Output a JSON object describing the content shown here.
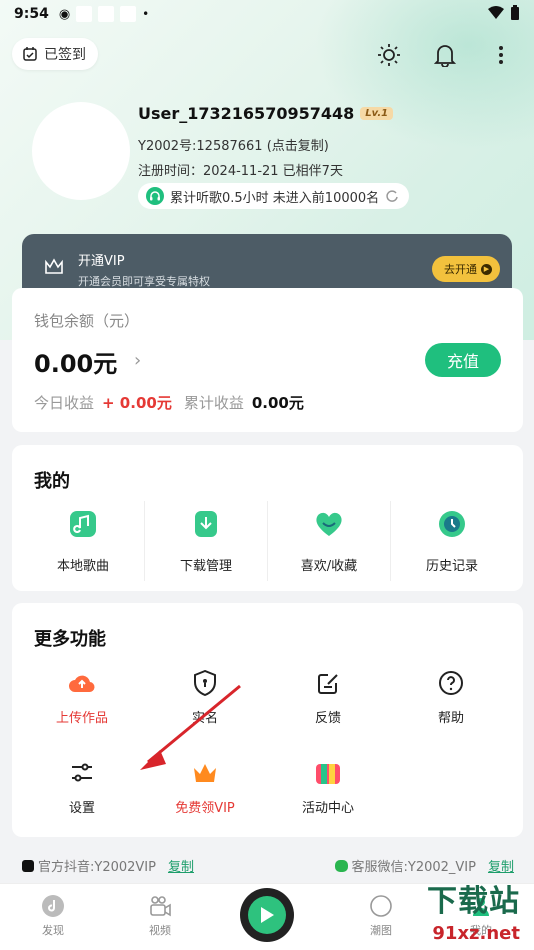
{
  "status_bar": {
    "time": "9:54"
  },
  "header": {
    "checkin_label": "已签到",
    "username": "User_173216570957448",
    "level": "Lv.1",
    "id_line": "Y2002号:12587661 (点击复制)",
    "register_line": "注册时间：2024-11-21 已相伴7天",
    "listen_line": "累计听歌0.5小时 未进入前10000名"
  },
  "vip": {
    "title": "开通VIP",
    "subtitle": "开通会员即可享受专属特权",
    "button": "去开通"
  },
  "wallet": {
    "label": "钱包余额（元）",
    "amount": "0.00元",
    "recharge": "充值",
    "today_label": "今日收益",
    "today_value": "+ 0.00元",
    "total_label": "累计收益",
    "total_value": "0.00元"
  },
  "mine": {
    "title": "我的",
    "items": [
      {
        "label": "本地歌曲",
        "icon": "local-music-icon"
      },
      {
        "label": "下载管理",
        "icon": "download-icon"
      },
      {
        "label": "喜欢/收藏",
        "icon": "heart-icon"
      },
      {
        "label": "历史记录",
        "icon": "history-icon"
      }
    ]
  },
  "more": {
    "title": "更多功能",
    "items": [
      {
        "label": "上传作品",
        "icon": "upload-cloud-icon"
      },
      {
        "label": "实名",
        "icon": "shield-icon"
      },
      {
        "label": "反馈",
        "icon": "feedback-icon"
      },
      {
        "label": "帮助",
        "icon": "help-icon"
      },
      {
        "label": "设置",
        "icon": "settings-sliders-icon"
      },
      {
        "label": "免费领VIP",
        "icon": "crown-icon"
      },
      {
        "label": "活动中心",
        "icon": "gift-icon"
      }
    ]
  },
  "contacts": {
    "douyin": "官方抖音:Y2002VIP",
    "wechat": "客服微信:Y2002_VIP",
    "copy": "复制"
  },
  "tabs": {
    "discover": "发现",
    "video": "视频",
    "trend": "潮图",
    "mine": "我的"
  },
  "watermark": {
    "line1": "下载站",
    "line2": "91xz.net"
  },
  "colors": {
    "accent": "#1fbf7e",
    "danger": "#e53935",
    "vip_gold": "#f2c13d",
    "vip_bg": "#4d5c66"
  }
}
